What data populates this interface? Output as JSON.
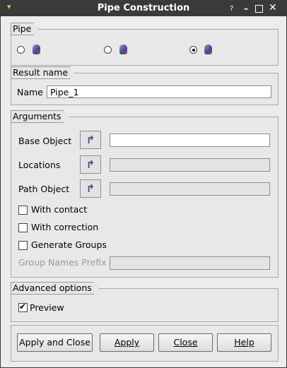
{
  "window": {
    "title": "Pipe Construction"
  },
  "titlebar": {
    "help": "?",
    "minimize": "▬",
    "close": "✕"
  },
  "pipe_group": {
    "label": "Pipe",
    "options": [
      {
        "name": "pipe-option-1",
        "checked": false
      },
      {
        "name": "pipe-option-2",
        "checked": false
      },
      {
        "name": "pipe-option-3",
        "checked": true
      }
    ]
  },
  "result_group": {
    "label": "Result name",
    "name_label": "Name",
    "name_value": "Pipe_1"
  },
  "arguments_group": {
    "label": "Arguments",
    "base_object_label": "Base Object",
    "locations_label": "Locations",
    "path_object_label": "Path Object",
    "base_object_value": "",
    "locations_value": "",
    "path_object_value": "",
    "with_contact_label": "With contact",
    "with_correction_label": "With correction",
    "generate_groups_label": "Generate Groups",
    "group_names_prefix_label": "Group Names Prefix",
    "group_names_prefix_value": ""
  },
  "advanced_group": {
    "label": "Advanced options",
    "preview_label": "Preview",
    "preview_checked": true
  },
  "buttons": {
    "apply_close": "Apply and Close",
    "apply": "Apply",
    "close": "Close",
    "help": "Help"
  },
  "icons": {
    "selection_arrow": "↱"
  }
}
